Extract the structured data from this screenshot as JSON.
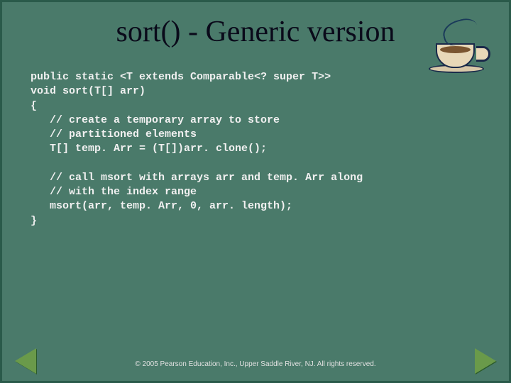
{
  "slide": {
    "title": "sort() - Generic version",
    "code": "public static <T extends Comparable<? super T>>\nvoid sort(T[] arr)\n{\n   // create a temporary array to store\n   // partitioned elements\n   T[] temp. Arr = (T[])arr. clone();\n\n   // call msort with arrays arr and temp. Arr along\n   // with the index range\n   msort(arr, temp. Arr, 0, arr. length);\n}",
    "footer": "© 2005 Pearson Education, Inc., Upper Saddle River, NJ.  All rights reserved."
  }
}
